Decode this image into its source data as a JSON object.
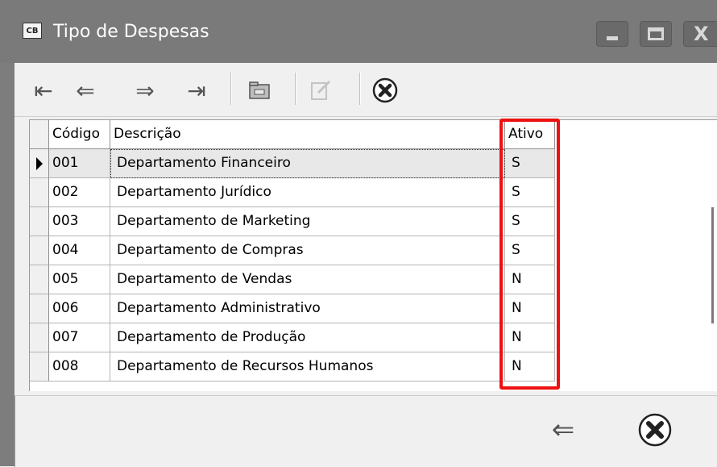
{
  "window": {
    "title": "Tipo de Despesas",
    "app_icon_text": "CB"
  },
  "toolbar": {
    "first_icon": "⇤",
    "prev_icon": "⇐",
    "next_icon": "⇒",
    "last_icon": "⇥",
    "close_icon": "✖"
  },
  "table": {
    "columns": [
      "Código",
      "Descrição",
      "Ativo"
    ],
    "rows": [
      {
        "codigo": "001",
        "descricao": "Departamento Financeiro",
        "ativo": "S"
      },
      {
        "codigo": "002",
        "descricao": "Departamento Jurídico",
        "ativo": "S"
      },
      {
        "codigo": "003",
        "descricao": "Departamento de Marketing",
        "ativo": "S"
      },
      {
        "codigo": "004",
        "descricao": "Departamento de Compras",
        "ativo": "S"
      },
      {
        "codigo": "005",
        "descricao": "Departamento de Vendas",
        "ativo": "N"
      },
      {
        "codigo": "006",
        "descricao": "Departamento Administrativo",
        "ativo": "N"
      },
      {
        "codigo": "007",
        "descricao": "Departamento de Produção",
        "ativo": "N"
      },
      {
        "codigo": "008",
        "descricao": "Departamento de Recursos Humanos",
        "ativo": "N"
      }
    ]
  },
  "footer": {
    "back_icon": "⇐",
    "close_icon": "✖"
  },
  "colors": {
    "highlight": "#ee1111",
    "titlebar": "#7a7a7a"
  }
}
